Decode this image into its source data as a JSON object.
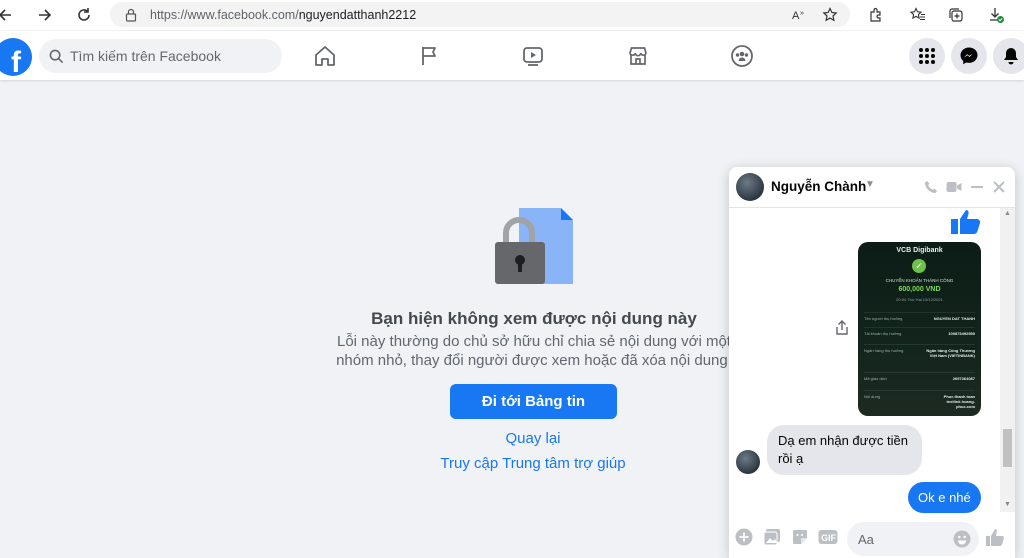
{
  "browser": {
    "url_host": "https://www.facebook.com/",
    "url_path": "nguyendatthanh2212"
  },
  "fb": {
    "logo_letter": "f",
    "search_placeholder": "Tìm kiếm trên Facebook"
  },
  "error_page": {
    "heading": "Bạn hiện không xem được nội dung này",
    "description_line1": "Lỗi này thường do chủ sở hữu chỉ chia sẻ nội dung với một",
    "description_line2": "nhóm nhỏ, thay đổi người được xem hoặc đã xóa nội dung.",
    "primary_button": "Đi tới Bảng tin",
    "back_link": "Quay lại",
    "help_link": "Truy cập Trung tâm trợ giúp"
  },
  "chat": {
    "contact_name": "Nguyễn Chành",
    "receipt": {
      "bank": "VCB Digibank",
      "status": "CHUYỂN KHOẢN THÀNH CÔNG",
      "amount": "600,000 VND",
      "time": "20:04 Thứ Hai 13/12/2021",
      "rows": [
        {
          "label": "Tên người thụ hưởng",
          "value": "NGUYEN DAT THANH"
        },
        {
          "label": "Tài khoản thụ hưởng",
          "value": "100873492950"
        },
        {
          "label": "Ngân hàng thụ hưởng",
          "value": "Ngân hàng Công Thương Việt Nam (VIETINBANK)"
        },
        {
          "label": "Mã giao dịch",
          "value": "2697364087"
        },
        {
          "label": "Nội dung",
          "value": "Phuc thanh toan textlink hoang-phuc.com"
        }
      ]
    },
    "messages": [
      {
        "direction": "in",
        "text": "Dạ em nhận được tiền rồi ạ"
      },
      {
        "direction": "out",
        "text": "Ok e nhé"
      }
    ],
    "input_placeholder": "Aa"
  },
  "colors": {
    "fb_blue": "#1877f2",
    "page_bg": "#f0f2f5",
    "receipt_green": "#7ed957"
  }
}
